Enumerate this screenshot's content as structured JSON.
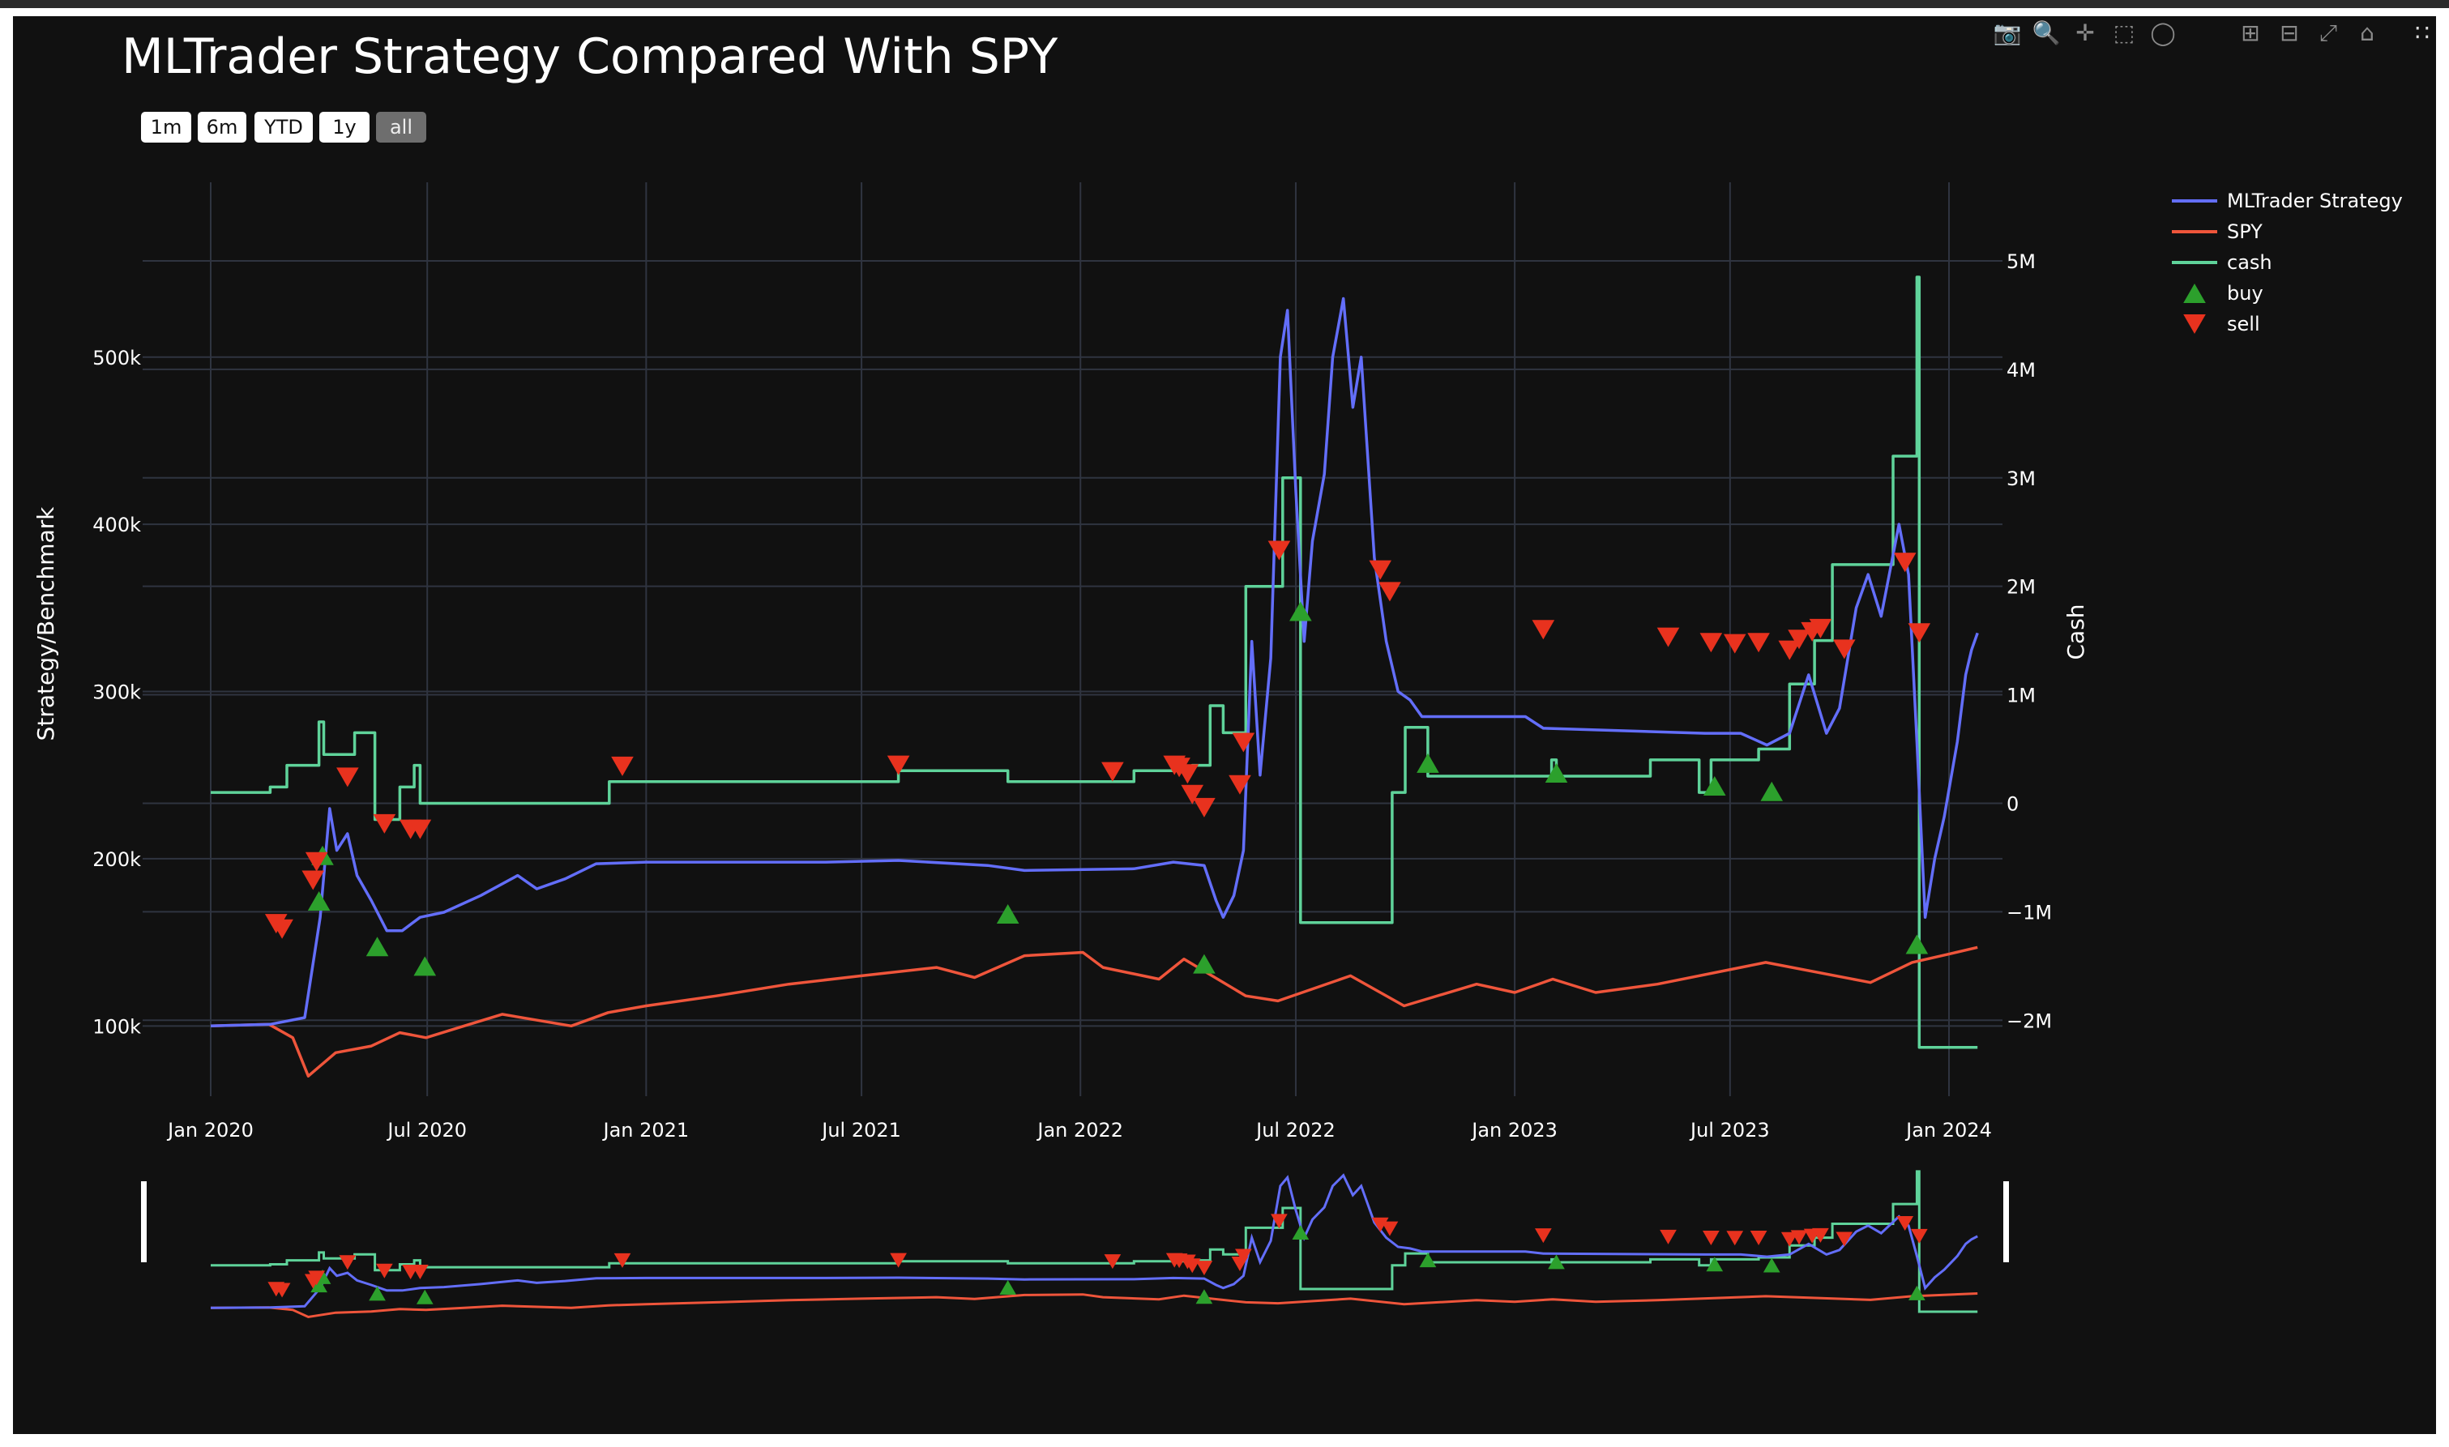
{
  "title": "MLTrader Strategy Compared With SPY",
  "range_buttons": [
    {
      "label": "1m",
      "active": false
    },
    {
      "label": "6m",
      "active": false
    },
    {
      "label": "YTD",
      "active": false
    },
    {
      "label": "1y",
      "active": false
    },
    {
      "label": "all",
      "active": true
    }
  ],
  "modebar_icons": [
    "camera-icon",
    "zoom-icon",
    "pan-icon",
    "box-select-icon",
    "lasso-icon",
    "zoom-in-icon",
    "zoom-out-icon",
    "autoscale-icon",
    "home-icon",
    "plotly-logo-icon"
  ],
  "chart_data": {
    "type": "line",
    "title": "MLTrader Strategy Compared With SPY",
    "xlabel": "",
    "ylabel": "Strategy/Benchmark",
    "y2label": "Cash",
    "xlim": [
      "2020-01-01",
      "2024-01-01"
    ],
    "ylim": [
      58000,
      590000
    ],
    "y2lim": [
      -2700000,
      5500000
    ],
    "x_ticks": [
      "Jan 2020",
      "Jul 2020",
      "Jan 2021",
      "Jul 2021",
      "Jan 2022",
      "Jul 2022",
      "Jan 2023",
      "Jul 2023",
      "Jan 2024"
    ],
    "y_ticks": [
      "100k",
      "200k",
      "300k",
      "400k",
      "500k"
    ],
    "y2_ticks": [
      "−2M",
      "−1M",
      "0",
      "1M",
      "2M",
      "3M",
      "4M",
      "5M"
    ],
    "grid": true,
    "legend_position": "top-right",
    "colors": {
      "strategy": "#636efa",
      "spy": "#ef553b",
      "cash": "#5fd39a",
      "buy": "#2ca02c",
      "sell": "#e8321e",
      "background": "#111111",
      "grid": "#2f3440"
    },
    "series": [
      {
        "name": "MLTrader Strategy",
        "axis": "y",
        "points": [
          [
            "2020-01-01",
            100000
          ],
          [
            "2020-02-20",
            101000
          ],
          [
            "2020-03-20",
            105000
          ],
          [
            "2020-04-02",
            165000
          ],
          [
            "2020-04-10",
            230000
          ],
          [
            "2020-04-16",
            205000
          ],
          [
            "2020-04-25",
            215000
          ],
          [
            "2020-05-03",
            190000
          ],
          [
            "2020-05-15",
            175000
          ],
          [
            "2020-05-28",
            157000
          ],
          [
            "2020-06-10",
            157000
          ],
          [
            "2020-06-25",
            165000
          ],
          [
            "2020-07-15",
            168000
          ],
          [
            "2020-08-15",
            178000
          ],
          [
            "2020-09-15",
            190000
          ],
          [
            "2020-10-01",
            182000
          ],
          [
            "2020-10-25",
            188000
          ],
          [
            "2020-11-20",
            197000
          ],
          [
            "2021-01-01",
            198000
          ],
          [
            "2021-06-01",
            198000
          ],
          [
            "2021-08-01",
            199000
          ],
          [
            "2021-10-15",
            196000
          ],
          [
            "2021-11-15",
            193000
          ],
          [
            "2022-02-15",
            194000
          ],
          [
            "2022-03-20",
            198000
          ],
          [
            "2022-04-15",
            196000
          ],
          [
            "2022-04-25",
            175000
          ],
          [
            "2022-05-01",
            165000
          ],
          [
            "2022-05-10",
            178000
          ],
          [
            "2022-05-18",
            205000
          ],
          [
            "2022-05-25",
            330000
          ],
          [
            "2022-06-01",
            250000
          ],
          [
            "2022-06-10",
            320000
          ],
          [
            "2022-06-18",
            500000
          ],
          [
            "2022-06-24",
            528000
          ],
          [
            "2022-07-01",
            420000
          ],
          [
            "2022-07-08",
            330000
          ],
          [
            "2022-07-15",
            390000
          ],
          [
            "2022-07-25",
            430000
          ],
          [
            "2022-08-01",
            500000
          ],
          [
            "2022-08-10",
            535000
          ],
          [
            "2022-08-18",
            470000
          ],
          [
            "2022-08-25",
            500000
          ],
          [
            "2022-09-05",
            380000
          ],
          [
            "2022-09-15",
            330000
          ],
          [
            "2022-09-25",
            300000
          ],
          [
            "2022-10-05",
            295000
          ],
          [
            "2022-10-15",
            285000
          ],
          [
            "2023-01-10",
            285000
          ],
          [
            "2023-01-25",
            278000
          ],
          [
            "2023-06-10",
            275000
          ],
          [
            "2023-07-10",
            275000
          ],
          [
            "2023-08-01",
            268000
          ],
          [
            "2023-08-20",
            275000
          ],
          [
            "2023-09-05",
            310000
          ],
          [
            "2023-09-20",
            275000
          ],
          [
            "2023-10-01",
            290000
          ],
          [
            "2023-10-15",
            350000
          ],
          [
            "2023-10-25",
            370000
          ],
          [
            "2023-11-05",
            345000
          ],
          [
            "2023-11-20",
            400000
          ],
          [
            "2023-11-28",
            370000
          ],
          [
            "2023-12-05",
            270000
          ],
          [
            "2023-12-12",
            165000
          ],
          [
            "2023-12-20",
            200000
          ],
          [
            "2023-12-28",
            225000
          ],
          [
            "2024-01-08",
            270000
          ],
          [
            "2024-01-15",
            310000
          ],
          [
            "2024-01-20",
            325000
          ],
          [
            "2024-01-25",
            335000
          ]
        ]
      },
      {
        "name": "SPY",
        "axis": "y",
        "points": [
          [
            "2020-01-01",
            100000
          ],
          [
            "2020-02-19",
            101000
          ],
          [
            "2020-03-10",
            93000
          ],
          [
            "2020-03-23",
            70000
          ],
          [
            "2020-04-15",
            84000
          ],
          [
            "2020-05-15",
            88000
          ],
          [
            "2020-06-08",
            96000
          ],
          [
            "2020-06-30",
            93000
          ],
          [
            "2020-08-01",
            100000
          ],
          [
            "2020-09-02",
            107000
          ],
          [
            "2020-10-30",
            100000
          ],
          [
            "2020-11-30",
            108000
          ],
          [
            "2021-01-01",
            112000
          ],
          [
            "2021-03-01",
            118000
          ],
          [
            "2021-05-01",
            125000
          ],
          [
            "2021-07-01",
            130000
          ],
          [
            "2021-09-02",
            135000
          ],
          [
            "2021-10-04",
            129000
          ],
          [
            "2021-11-15",
            142000
          ],
          [
            "2022-01-03",
            144000
          ],
          [
            "2022-01-20",
            135000
          ],
          [
            "2022-03-08",
            128000
          ],
          [
            "2022-03-29",
            140000
          ],
          [
            "2022-05-20",
            118000
          ],
          [
            "2022-06-16",
            115000
          ],
          [
            "2022-08-16",
            130000
          ],
          [
            "2022-09-30",
            112000
          ],
          [
            "2022-11-30",
            125000
          ],
          [
            "2023-01-01",
            120000
          ],
          [
            "2023-02-02",
            128000
          ],
          [
            "2023-03-10",
            120000
          ],
          [
            "2023-05-01",
            125000
          ],
          [
            "2023-07-31",
            138000
          ],
          [
            "2023-10-27",
            126000
          ],
          [
            "2023-12-01",
            138000
          ],
          [
            "2024-01-01",
            143000
          ],
          [
            "2024-01-25",
            147000
          ]
        ]
      },
      {
        "name": "cash",
        "axis": "y2",
        "points": [
          [
            "2020-01-01",
            100000
          ],
          [
            "2020-02-20",
            100000
          ],
          [
            "2020-02-20",
            150000
          ],
          [
            "2020-03-05",
            150000
          ],
          [
            "2020-03-05",
            350000
          ],
          [
            "2020-04-01",
            350000
          ],
          [
            "2020-04-01",
            750000
          ],
          [
            "2020-04-05",
            750000
          ],
          [
            "2020-04-05",
            450000
          ],
          [
            "2020-05-01",
            450000
          ],
          [
            "2020-05-01",
            650000
          ],
          [
            "2020-05-18",
            650000
          ],
          [
            "2020-05-18",
            -150000
          ],
          [
            "2020-06-08",
            -150000
          ],
          [
            "2020-06-08",
            150000
          ],
          [
            "2020-06-20",
            150000
          ],
          [
            "2020-06-20",
            350000
          ],
          [
            "2020-06-25",
            350000
          ],
          [
            "2020-06-25",
            0
          ],
          [
            "2020-12-01",
            0
          ],
          [
            "2020-12-01",
            200000
          ],
          [
            "2021-08-01",
            200000
          ],
          [
            "2021-08-01",
            300000
          ],
          [
            "2021-11-01",
            300000
          ],
          [
            "2021-11-01",
            200000
          ],
          [
            "2022-02-15",
            200000
          ],
          [
            "2022-02-15",
            300000
          ],
          [
            "2022-04-05",
            300000
          ],
          [
            "2022-04-05",
            350000
          ],
          [
            "2022-04-20",
            350000
          ],
          [
            "2022-04-20",
            900000
          ],
          [
            "2022-05-01",
            900000
          ],
          [
            "2022-05-01",
            650000
          ],
          [
            "2022-05-20",
            650000
          ],
          [
            "2022-05-20",
            2000000
          ],
          [
            "2022-06-20",
            2000000
          ],
          [
            "2022-06-20",
            3000000
          ],
          [
            "2022-07-05",
            3000000
          ],
          [
            "2022-07-05",
            -1100000
          ],
          [
            "2022-09-20",
            -1100000
          ],
          [
            "2022-09-20",
            100000
          ],
          [
            "2022-10-01",
            100000
          ],
          [
            "2022-10-01",
            700000
          ],
          [
            "2022-10-20",
            700000
          ],
          [
            "2022-10-20",
            250000
          ],
          [
            "2023-02-01",
            250000
          ],
          [
            "2023-02-01",
            400000
          ],
          [
            "2023-02-05",
            400000
          ],
          [
            "2023-02-05",
            250000
          ],
          [
            "2023-04-25",
            250000
          ],
          [
            "2023-04-25",
            400000
          ],
          [
            "2023-06-05",
            400000
          ],
          [
            "2023-06-05",
            100000
          ],
          [
            "2023-06-15",
            100000
          ],
          [
            "2023-06-15",
            400000
          ],
          [
            "2023-07-25",
            400000
          ],
          [
            "2023-07-25",
            500000
          ],
          [
            "2023-08-20",
            500000
          ],
          [
            "2023-08-20",
            1100000
          ],
          [
            "2023-09-10",
            1100000
          ],
          [
            "2023-09-10",
            1500000
          ],
          [
            "2023-09-25",
            1500000
          ],
          [
            "2023-09-25",
            2200000
          ],
          [
            "2023-11-15",
            2200000
          ],
          [
            "2023-11-15",
            3200000
          ],
          [
            "2023-12-05",
            3200000
          ],
          [
            "2023-12-05",
            4850000
          ],
          [
            "2023-12-07",
            4850000
          ],
          [
            "2023-12-07",
            -2250000
          ],
          [
            "2024-01-25",
            -2250000
          ]
        ]
      }
    ],
    "markers": {
      "buy": [
        [
          "2020-04-01",
          -900000
        ],
        [
          "2020-04-04",
          -480000
        ],
        [
          "2020-05-20",
          -1320000
        ],
        [
          "2020-06-29",
          -1500000
        ],
        [
          "2021-11-01",
          -1020000
        ],
        [
          "2022-04-15",
          -1480000
        ],
        [
          "2022-07-05",
          1770000
        ],
        [
          "2022-10-20",
          370000
        ],
        [
          "2023-02-05",
          280000
        ],
        [
          "2023-06-18",
          160000
        ],
        [
          "2023-08-05",
          110000
        ],
        [
          "2023-12-05",
          -1300000
        ]
      ],
      "sell": [
        [
          "2020-02-25",
          -1110000
        ],
        [
          "2020-03-01",
          -1160000
        ],
        [
          "2020-03-27",
          -710000
        ],
        [
          "2020-03-30",
          -540000
        ],
        [
          "2020-04-25",
          240000
        ],
        [
          "2020-05-26",
          -190000
        ],
        [
          "2020-06-17",
          -240000
        ],
        [
          "2020-06-25",
          -240000
        ],
        [
          "2020-12-12",
          340000
        ],
        [
          "2021-08-01",
          350000
        ],
        [
          "2022-01-28",
          290000
        ],
        [
          "2022-03-21",
          350000
        ],
        [
          "2022-03-25",
          330000
        ],
        [
          "2022-04-01",
          270000
        ],
        [
          "2022-04-05",
          80000
        ],
        [
          "2022-04-15",
          -40000
        ],
        [
          "2022-05-15",
          170000
        ],
        [
          "2022-05-18",
          560000
        ],
        [
          "2022-06-17",
          2330000
        ],
        [
          "2022-09-10",
          2150000
        ],
        [
          "2022-09-18",
          1950000
        ],
        [
          "2023-01-25",
          1600000
        ],
        [
          "2023-05-10",
          1530000
        ],
        [
          "2023-06-15",
          1480000
        ],
        [
          "2023-07-05",
          1470000
        ],
        [
          "2023-07-25",
          1480000
        ],
        [
          "2023-08-20",
          1410000
        ],
        [
          "2023-08-28",
          1510000
        ],
        [
          "2023-09-08",
          1580000
        ],
        [
          "2023-09-15",
          1610000
        ],
        [
          "2023-10-05",
          1420000
        ],
        [
          "2023-11-25",
          2220000
        ],
        [
          "2023-12-07",
          1570000
        ]
      ]
    }
  },
  "legend": [
    {
      "label": "MLTrader Strategy",
      "symbol": "line",
      "color": "#636efa"
    },
    {
      "label": "SPY",
      "symbol": "line",
      "color": "#ef553b"
    },
    {
      "label": "cash",
      "symbol": "line",
      "color": "#5fd39a"
    },
    {
      "label": "buy",
      "symbol": "triangle-up",
      "color": "#2ca02c"
    },
    {
      "label": "sell",
      "symbol": "triangle-down",
      "color": "#e8321e"
    }
  ]
}
